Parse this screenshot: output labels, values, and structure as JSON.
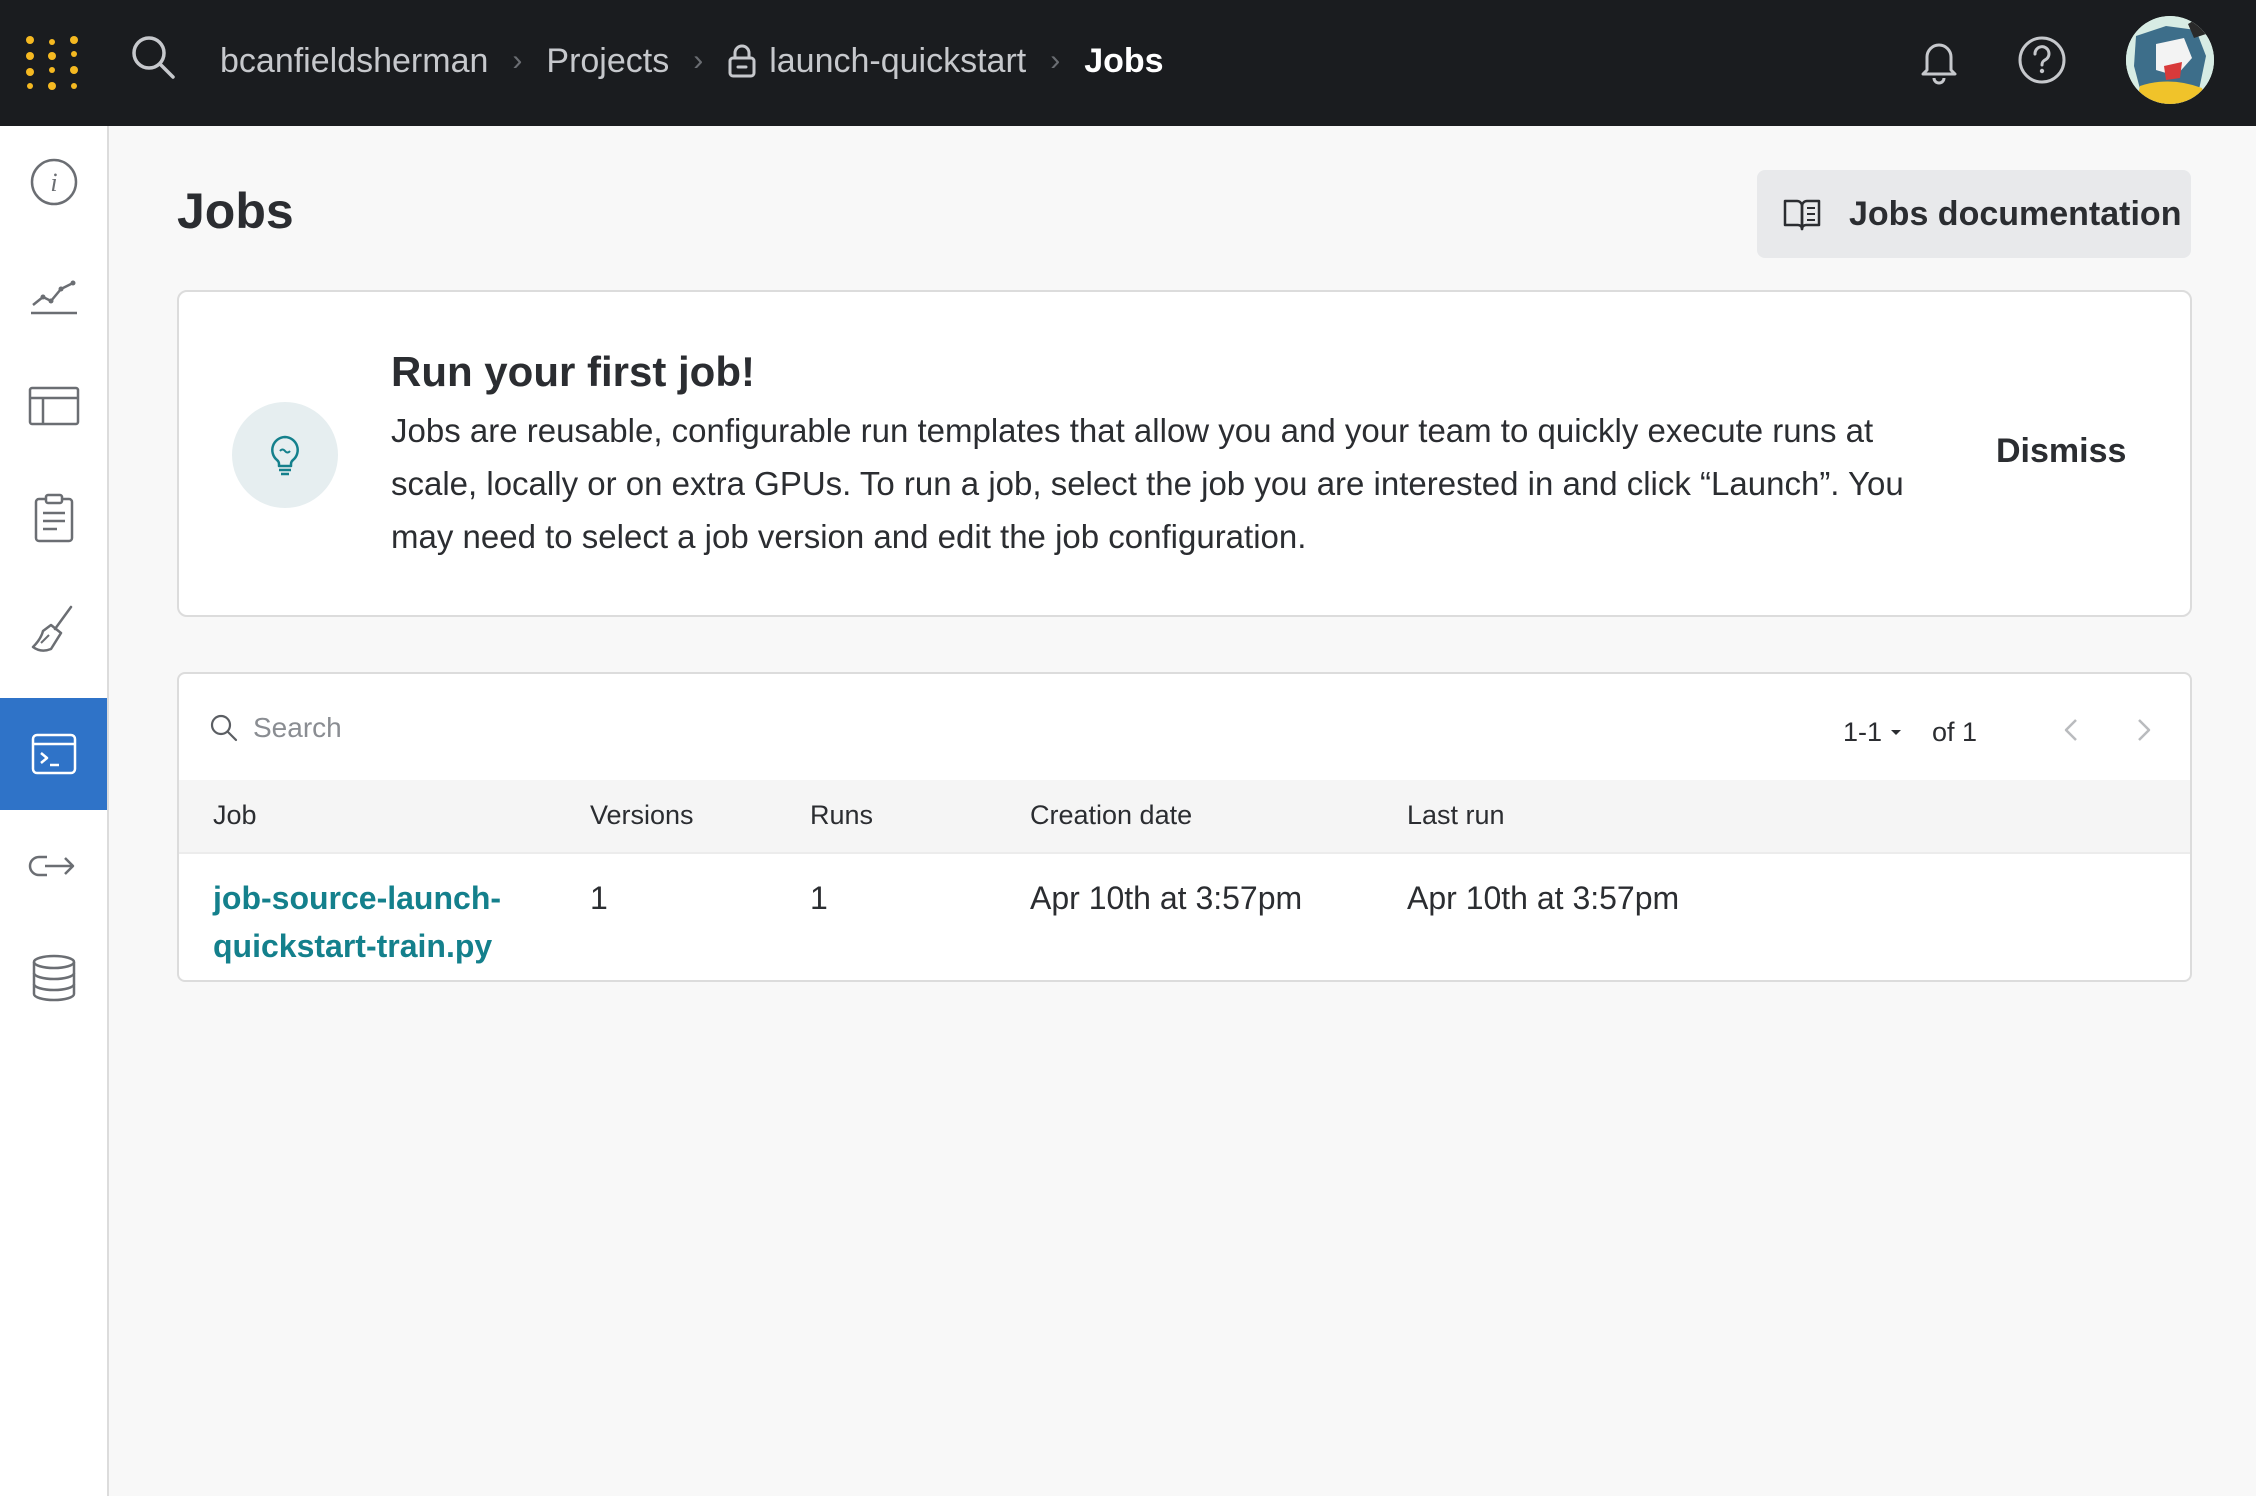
{
  "colors": {
    "topbar_bg": "#1a1c1f",
    "sidebar_active": "#2f73c8",
    "link": "#14808c",
    "logo_yellow": "#f5b921"
  },
  "header": {
    "breadcrumb": [
      {
        "label": "bcanfieldsherman"
      },
      {
        "label": "Projects"
      },
      {
        "label": "launch-quickstart",
        "icon": "lock-icon"
      },
      {
        "label": "Jobs"
      }
    ],
    "icons": [
      "wandb-logo",
      "search-icon",
      "bell-icon",
      "help-icon",
      "avatar"
    ]
  },
  "sidebar": {
    "items": [
      {
        "icon": "info-icon",
        "active": false
      },
      {
        "icon": "chart-line-icon",
        "active": false
      },
      {
        "icon": "table-icon",
        "active": false
      },
      {
        "icon": "clipboard-report-icon",
        "active": false
      },
      {
        "icon": "sweep-broom-icon",
        "active": false
      },
      {
        "icon": "terminal-jobs-icon",
        "active": true
      },
      {
        "icon": "launch-arrow-icon",
        "active": false
      },
      {
        "icon": "database-icon",
        "active": false
      }
    ]
  },
  "main": {
    "title": "Jobs",
    "doc_button_label": "Jobs documentation",
    "banner": {
      "title": "Run your first job!",
      "body": "Jobs are reusable, configurable run templates that allow you and your team to quickly execute runs at scale, locally or on extra GPUs. To run a job, select the job you are interested in and click “Launch”. You may need to select a job version and edit the job configuration.",
      "dismiss_label": "Dismiss",
      "icon": "lightbulb-icon"
    },
    "table": {
      "search_placeholder": "Search",
      "pager_range": "1-1",
      "pager_of": "of 1",
      "columns": [
        "Job",
        "Versions",
        "Runs",
        "Creation date",
        "Last run"
      ],
      "rows": [
        {
          "job": "job-source-launch-quickstart-train.py",
          "versions": "1",
          "runs": "1",
          "creation_date": "Apr 10th at 3:57pm",
          "last_run": "Apr 10th at 3:57pm"
        }
      ]
    }
  }
}
